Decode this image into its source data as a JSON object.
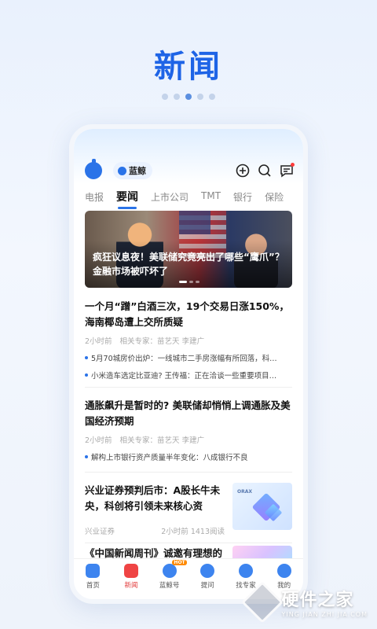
{
  "headline": "新闻",
  "pager": {
    "count": 5,
    "active_index": 2
  },
  "app": {
    "brand_label": "蓝鲸",
    "tabs": [
      "电报",
      "要闻",
      "上市公司",
      "TMT",
      "银行",
      "保险"
    ],
    "active_tab": "要闻",
    "banner": {
      "text": "疯狂议息夜！美联储究竟亮出了哪些“鹰爪”？金融市场被吓坏了"
    },
    "articles": [
      {
        "title": "一个月“蹭”白酒三次，19个交易日涨150%，海南椰岛遭上交所质疑",
        "time": "2小时前",
        "experts": "相关专家：苗艺天  李建广",
        "bullets": [
          "5月70城房价出炉：一线城市二手房涨幅有所回落，科…",
          "小米造车选定比亚迪? 王传福：正在洽谈一些重要项目…"
        ]
      },
      {
        "title": "通胀飙升是暂时的? 美联储却悄悄上调通胀及美国经济预期",
        "time": "2小时前",
        "experts": "相关专家：苗艺天  李建广",
        "bullets": [
          "解构上市银行资产质量半年变化：八成银行不良"
        ]
      },
      {
        "title": "兴业证券预判后市：A股长牛未央，科创将引领未来核心资",
        "source": "兴业证券",
        "time": "2小时前",
        "reads": "1413阅读"
      },
      {
        "title": "《中国新闻周刊》诚邀有理想的媒体人加入未来新闻队"
      }
    ],
    "bottom_nav": [
      {
        "label": "首页",
        "icon": "home-icon"
      },
      {
        "label": "新闻",
        "icon": "news-icon"
      },
      {
        "label": "蓝鲸号",
        "icon": "whale-icon",
        "badge": "HOT"
      },
      {
        "label": "提问",
        "icon": "question-icon"
      },
      {
        "label": "找专家",
        "icon": "expert-icon"
      },
      {
        "label": "我的",
        "icon": "profile-icon"
      }
    ],
    "active_nav": "新闻"
  },
  "watermark": {
    "cn": "硬件之家",
    "en": "YING JIAN ZHI JIA.COM"
  },
  "colors": {
    "accent": "#1e64e6",
    "brand_blue": "#2a73e8",
    "alert_red": "#ef4444"
  }
}
